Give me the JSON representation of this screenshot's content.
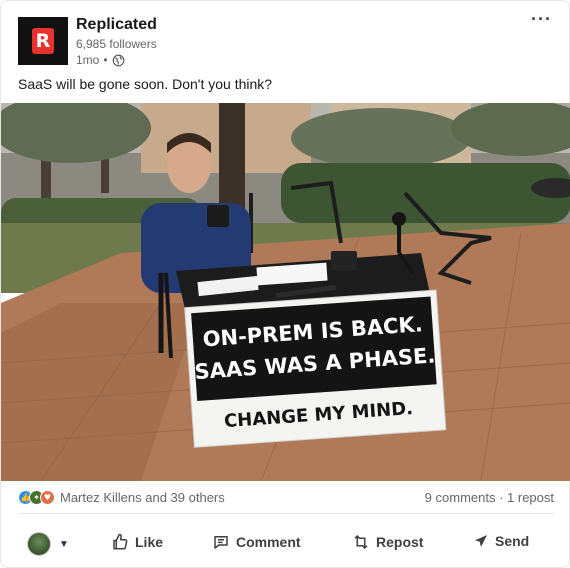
{
  "post": {
    "author": {
      "name": "Replicated",
      "followers": "6,985 followers",
      "time": "1mo",
      "visibility_icon": "globe-icon",
      "logo_letter": "R"
    },
    "more_label": "···",
    "text": "SaaS will be gone soon. Don't you think?",
    "image": {
      "sign_line1": "ON-PREM IS BACK.",
      "sign_line2": "SAAS WAS A PHASE.",
      "sign_line3": "CHANGE MY MIND."
    }
  },
  "social": {
    "reaction_icons": [
      "like-icon",
      "celebrate-icon",
      "love-icon"
    ],
    "reactors": "Martez Killens and 39 others",
    "counts": "9 comments · 1 repost"
  },
  "actions": {
    "like": "Like",
    "comment": "Comment",
    "repost": "Repost",
    "send": "Send"
  },
  "colors": {
    "brand_red": "#e8322e",
    "like_blue": "#378fe9",
    "celebrate_green": "#44712e",
    "love_red": "#df704d"
  }
}
